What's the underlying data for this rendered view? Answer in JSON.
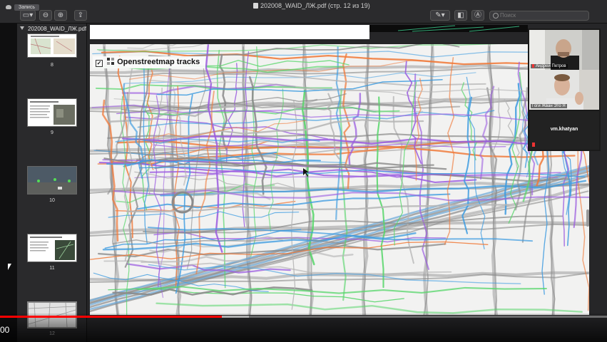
{
  "window": {
    "title": "202008_WAID_ЛЖ.pdf (стр. 12 из 19)",
    "tab_chip": "Запись",
    "search_placeholder": "Поиск"
  },
  "toolbar": {
    "sidebar_toggle_icon": "sidebar-icon",
    "zoom_out_icon": "zoom-out-icon",
    "zoom_in_icon": "zoom-in-icon",
    "share_icon": "share-icon",
    "markup_icon": "pen-icon",
    "rotate_icon": "rotate-icon",
    "annotate_icon": "annotate-icon"
  },
  "sidebar": {
    "header": "202008_WAID_ЛЖ.pdf",
    "pages": [
      {
        "number": "8"
      },
      {
        "number": "9"
      },
      {
        "number": "10"
      },
      {
        "number": "11"
      },
      {
        "number": "12"
      }
    ]
  },
  "map": {
    "layer_label": "Openstreetmap tracks",
    "layer_checked": true
  },
  "video_call": {
    "participants": [
      {
        "name": "Андрей Петров"
      },
      {
        "name": "Гоги Жван Это Я"
      },
      {
        "name": "vm.khatyan"
      }
    ]
  },
  "player": {
    "time": "00",
    "progress": 0.365,
    "buffered": 0.41
  },
  "colors": {
    "progress": "#ff0000",
    "accent_track_blue": "#3d9be0",
    "accent_track_green": "#57d66a",
    "accent_track_orange": "#f07a3a",
    "accent_track_purple": "#9b5ce0"
  }
}
